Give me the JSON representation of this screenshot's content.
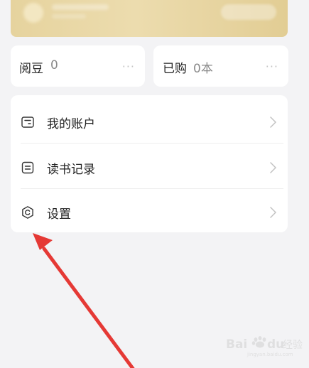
{
  "stats": {
    "beans": {
      "label": "阅豆",
      "value": "0",
      "more": "···"
    },
    "purchased": {
      "label": "已购",
      "value": "0本",
      "more": "···"
    }
  },
  "menu": {
    "items": [
      {
        "label": "我的账户",
        "icon": "wallet-icon"
      },
      {
        "label": "读书记录",
        "icon": "reading-record-icon"
      },
      {
        "label": "设置",
        "icon": "settings-icon"
      }
    ]
  },
  "annotation": {
    "color": "#e53935"
  },
  "watermark": {
    "brand": "Bai du",
    "suffix": "经验",
    "url": "jingyan.baidu.com"
  },
  "colors": {
    "background": "#f3f3f5",
    "card": "#ffffff",
    "gold": "#e6d39e",
    "text": "#222222",
    "muted": "#8a8a8a"
  }
}
